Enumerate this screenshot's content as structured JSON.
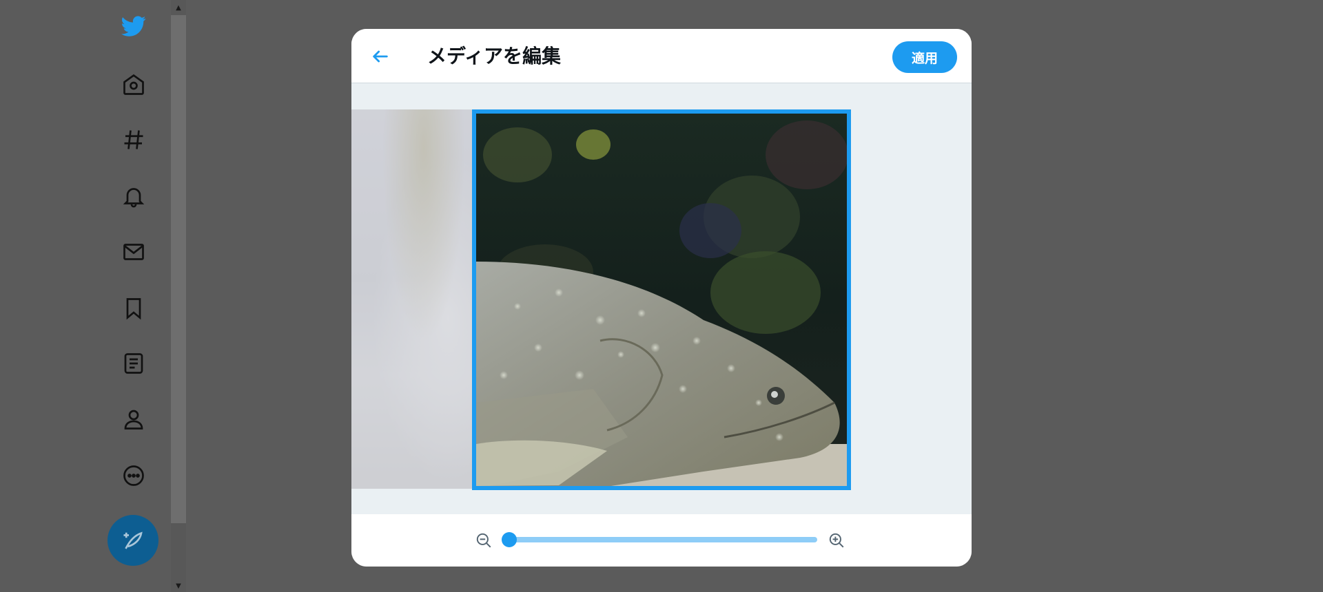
{
  "app": {
    "nav_icons": [
      "twitter-bird-icon",
      "home-icon",
      "hashtag-icon",
      "bell-icon",
      "envelope-icon",
      "bookmark-icon",
      "list-icon",
      "profile-icon",
      "more-icon"
    ],
    "compose_icon": "compose-feather-icon"
  },
  "modal": {
    "title": "メディアを編集",
    "apply_label": "適用",
    "back_icon": "arrow-left-icon"
  },
  "zoom": {
    "value": 0.0,
    "min_icon": "zoom-out-icon",
    "max_icon": "zoom-in-icon"
  },
  "colors": {
    "accent": "#1d9bf0",
    "track": "#8ecdf7",
    "overlay": "#5b5b5b"
  }
}
